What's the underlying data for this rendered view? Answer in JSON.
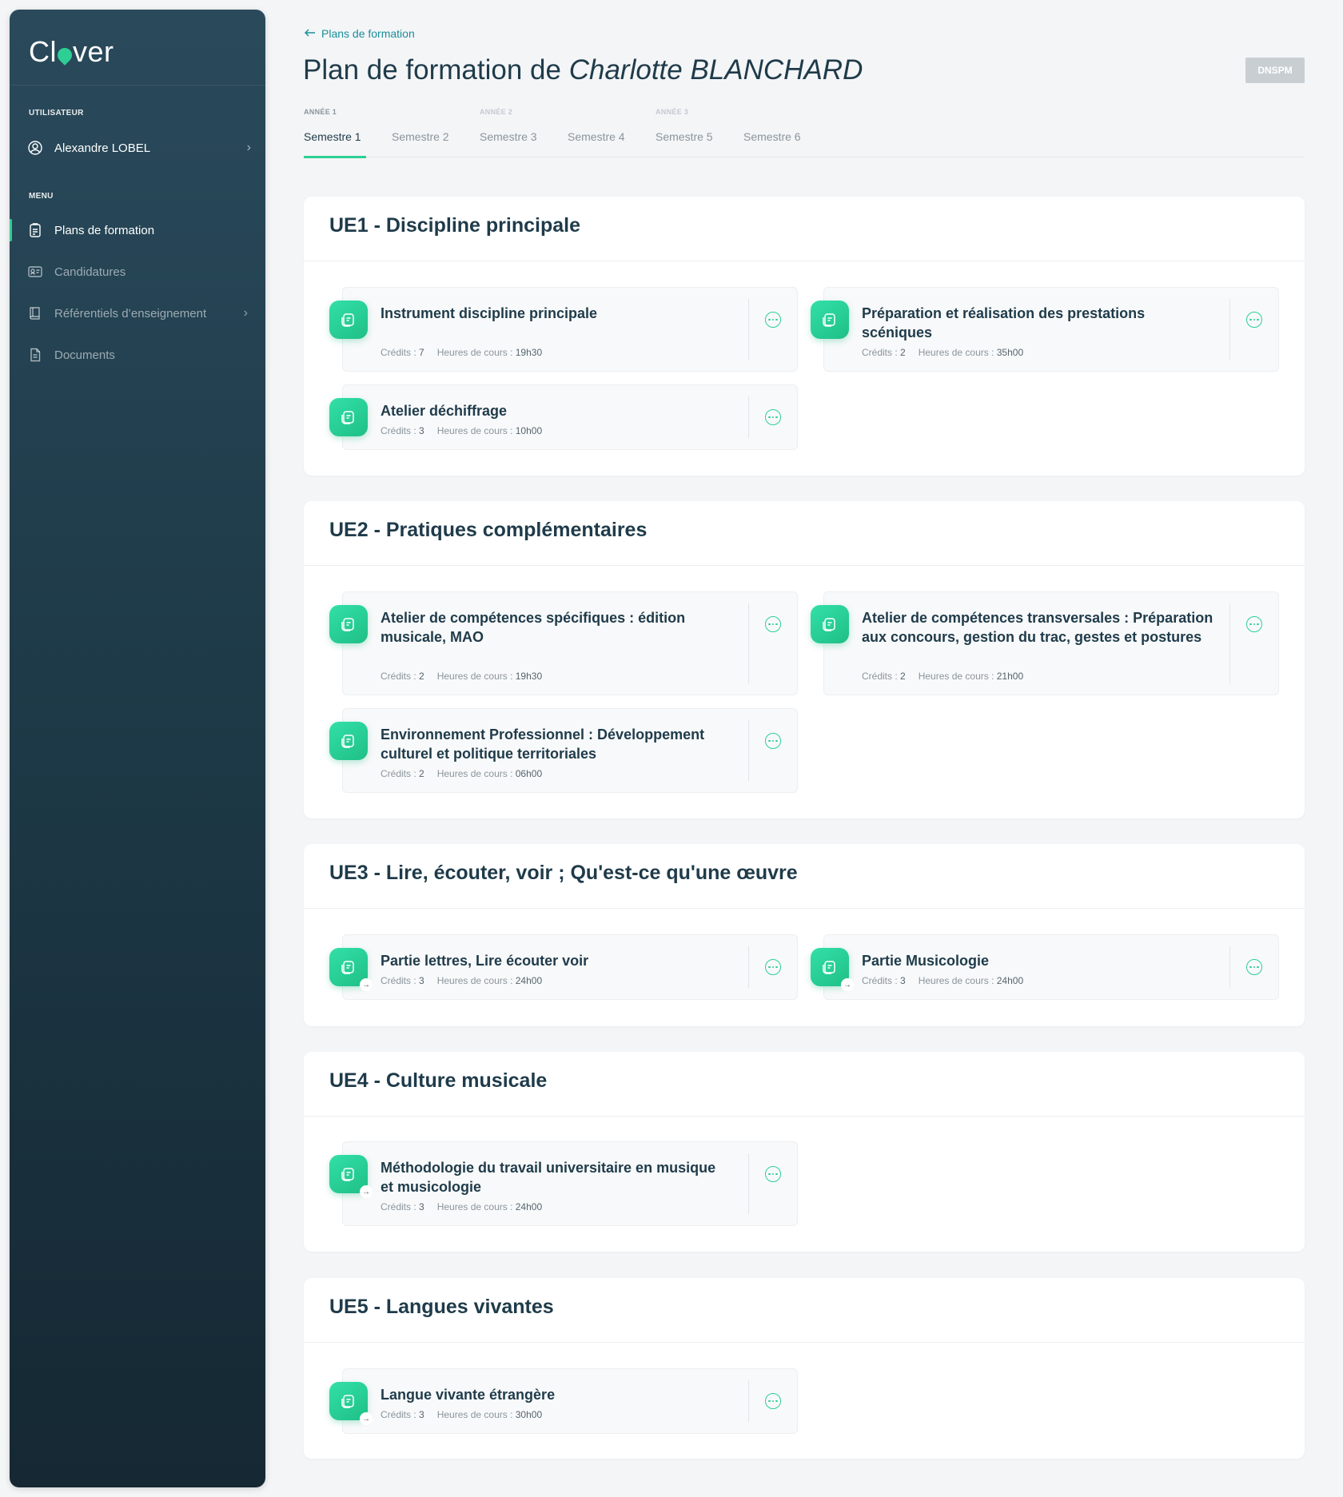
{
  "sidebar": {
    "logo": {
      "pre": "Cl",
      "post": "ver"
    },
    "user_section": "UTILISATEUR",
    "user_name": "Alexandre LOBEL",
    "menu_section": "MENU",
    "items": [
      {
        "label": "Plans de formation",
        "icon": "clipboard-icon",
        "active": true
      },
      {
        "label": "Candidatures",
        "icon": "id-card-icon"
      },
      {
        "label": "Référentiels d’enseignement",
        "icon": "book-icon"
      },
      {
        "label": "Documents",
        "icon": "document-icon"
      }
    ]
  },
  "header": {
    "back_label": "Plans de formation",
    "title_prefix": "Plan de formation de ",
    "title_name": "Charlotte BLANCHARD",
    "badge": "DNSPM"
  },
  "years": [
    "ANNÉE 1",
    "ANNÉE 2",
    "ANNÉE 3"
  ],
  "tabs": [
    "Semestre 1",
    "Semestre 2",
    "Semestre 3",
    "Semestre 4",
    "Semestre 5",
    "Semestre 6"
  ],
  "active_tab": "Semestre 1",
  "meta_labels": {
    "credits": "Crédits : ",
    "hours": "Heures de cours : "
  },
  "ues": [
    {
      "title": "UE1 - Discipline principale",
      "courses": [
        {
          "title": "Instrument discipline principale",
          "credits": "7",
          "hours": "19h30"
        },
        {
          "title": "Préparation et réalisation des prestations scéniques",
          "credits": "2",
          "hours": "35h00"
        },
        {
          "title": "Atelier déchiffrage",
          "credits": "3",
          "hours": "10h00"
        }
      ]
    },
    {
      "title": "UE2 - Pratiques complémentaires",
      "courses": [
        {
          "title": "Atelier de compétences spécifiques : édition musicale, MAO",
          "credits": "2",
          "hours": "19h30"
        },
        {
          "title": "Atelier de compétences transversales : Préparation aux concours, gestion du trac, gestes et postures",
          "credits": "2",
          "hours": "21h00"
        },
        {
          "title": "Environnement Professionnel : Développement culturel et politique territoriales",
          "credits": "2",
          "hours": "06h00"
        }
      ]
    },
    {
      "title": "UE3 - Lire, écouter, voir ; Qu'est-ce qu'une œuvre",
      "courses": [
        {
          "title": "Partie lettres, Lire écouter voir",
          "credits": "3",
          "hours": "24h00"
        },
        {
          "title": "Partie Musicologie",
          "credits": "3",
          "hours": "24h00"
        }
      ]
    },
    {
      "title": "UE4 - Culture musicale",
      "courses": [
        {
          "title": "Méthodologie du travail universitaire en musique et musicologie",
          "credits": "3",
          "hours": "24h00"
        }
      ]
    },
    {
      "title": "UE5 - Langues vivantes",
      "courses": [
        {
          "title": "Langue vivante étrangère",
          "credits": "3",
          "hours": "30h00"
        }
      ]
    }
  ],
  "colors": {
    "accent": "#2ecf95",
    "link": "#1a8f9a",
    "text": "#1f3b4a",
    "sidebar": "#1e3a48"
  }
}
